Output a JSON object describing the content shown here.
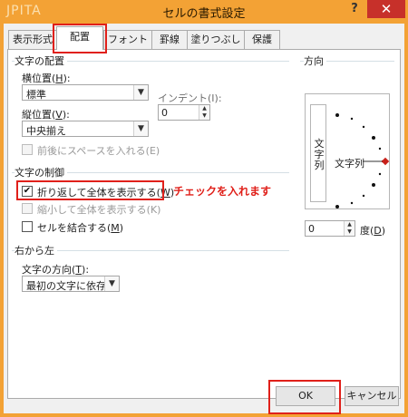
{
  "window": {
    "app_name": "JPITA",
    "title": "セルの書式設定",
    "help_label": "?",
    "close_label": "✕"
  },
  "tabs": [
    {
      "label": "表示形式"
    },
    {
      "label": "配置",
      "active": true
    },
    {
      "label": "フォント"
    },
    {
      "label": "罫線"
    },
    {
      "label": "塗りつぶし"
    },
    {
      "label": "保護"
    }
  ],
  "text_alignment": {
    "group_label": "文字の配置",
    "horizontal_label": "横位置(",
    "horizontal_key": "H",
    "horizontal_value": "標準",
    "vertical_label": "縦位置(",
    "vertical_key": "V",
    "vertical_value": "中央揃え",
    "indent_label": "インデント(I):",
    "indent_value": "0",
    "distributed_label": "前後にスペースを入れる(E)"
  },
  "text_control": {
    "group_label": "文字の制御",
    "wrap_label": "折り返して全体を表示する(",
    "wrap_key": "W",
    "wrap_checked": true,
    "shrink_label": "縮小して全体を表示する(K)",
    "merge_label": "セルを結合する(",
    "merge_key": "M",
    "merge_checked": false
  },
  "rtl": {
    "group_label": "右から左",
    "direction_label": "文字の方向(",
    "direction_key": "T",
    "direction_value": "最初の文字に依存"
  },
  "orientation": {
    "group_label": "方向",
    "vertical_text": [
      "文",
      "字",
      "列"
    ],
    "horizontal_text": "文字列",
    "degrees_value": "0",
    "degrees_label": "度(",
    "degrees_key": "D"
  },
  "annotation": "チェックを入れます",
  "buttons": {
    "ok": "OK",
    "cancel": "キャンセル"
  },
  "colors": {
    "title_bar": "#f3a235",
    "close_button": "#c7302a",
    "highlight_red": "#e0201a"
  }
}
